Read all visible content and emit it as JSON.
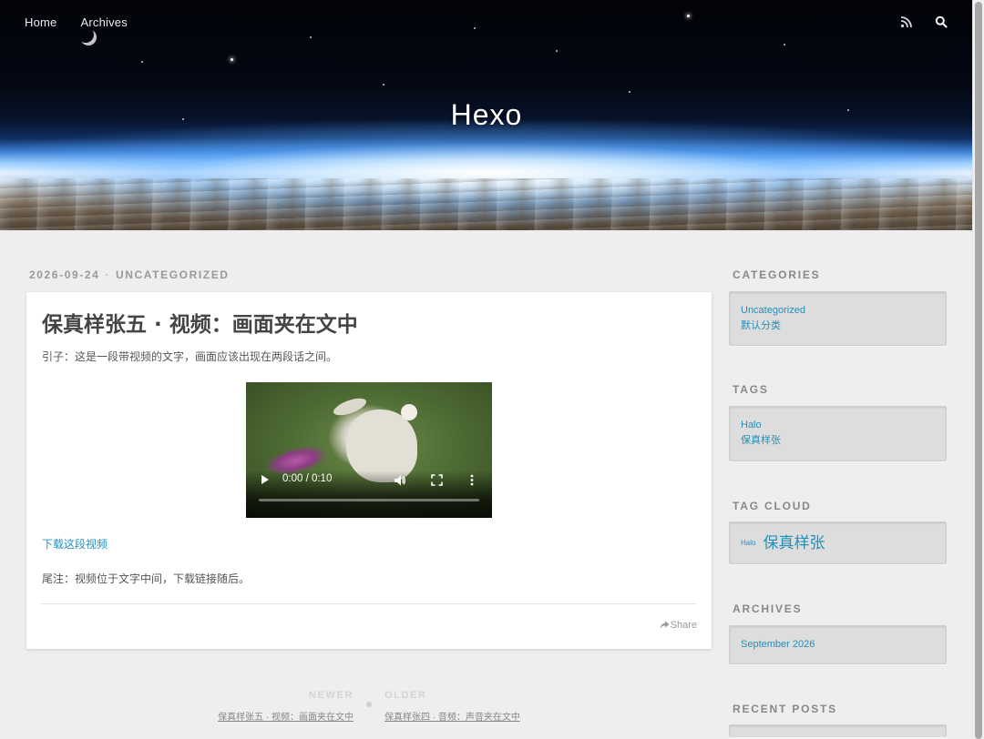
{
  "nav": {
    "left": [
      "Home",
      "Archives"
    ],
    "rss_icon": "rss-icon",
    "search_icon": "search-icon"
  },
  "site": {
    "title": "Hexo"
  },
  "article": {
    "date": "2026-09-24",
    "separator": "·",
    "category": "UNCATEGORIZED",
    "title": "保真样张五 · 视频：画面夹在文中",
    "intro": "引子：这是一段带视频的文字，画面应该出现在两段话之间。",
    "video": {
      "time": "0:00 / 0:10",
      "progress": 0
    },
    "download_link": "下载这段视频",
    "footnote": "尾注：视频位于文字中间，下载链接随后。",
    "share": "Share"
  },
  "pager": {
    "newer_label": "NEWER",
    "newer_title": "保真样张五 · 视频：画面夹在文中",
    "older_label": "OLDER",
    "older_title": "保真样张四 · 音频：声音夹在文中"
  },
  "sidebar": {
    "categories": {
      "title": "CATEGORIES",
      "items": [
        "Uncategorized",
        "默认分类"
      ]
    },
    "tags": {
      "title": "TAGS",
      "items": [
        "Halo",
        "保真样张"
      ]
    },
    "tag_cloud": {
      "title": "TAG CLOUD",
      "items": [
        "Halo",
        "保真样张"
      ]
    },
    "archives": {
      "title": "ARCHIVES",
      "items": [
        "September 2026"
      ]
    },
    "recent_posts": {
      "title": "RECENT POSTS"
    }
  },
  "colors": {
    "link": "#258fb8",
    "background": "#eeeeee"
  }
}
